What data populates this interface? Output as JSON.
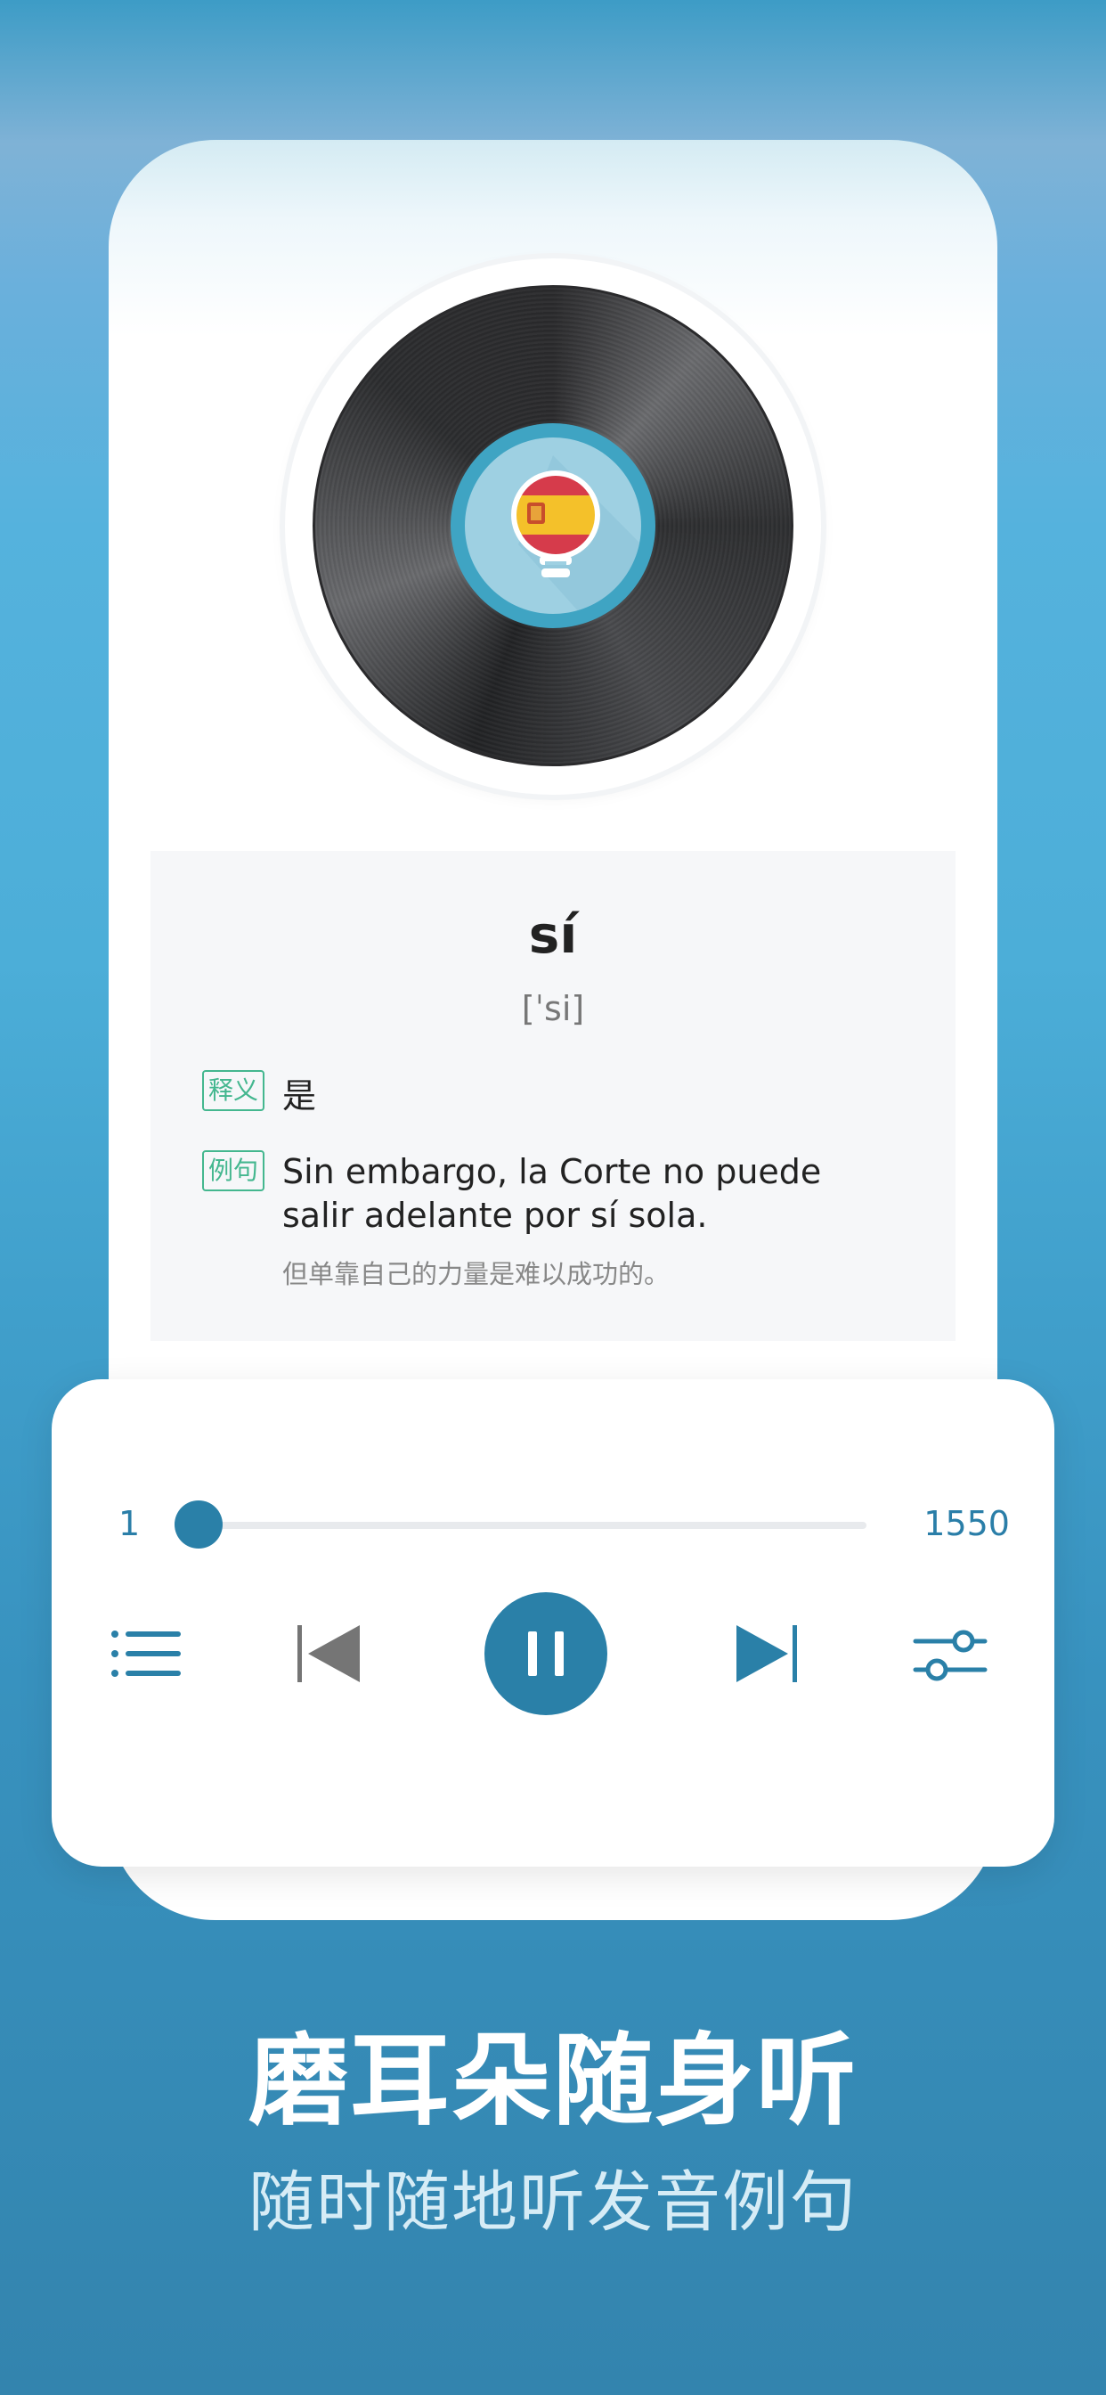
{
  "colors": {
    "accent": "#2a80a8",
    "tag_green": "#44b78f",
    "background_top": "#55b2dd",
    "background_bottom": "#3384ae"
  },
  "album_art": {
    "icon": "spain-flag-lightbulb-icon"
  },
  "word_card": {
    "word": "sí",
    "phonetic": "[ˈsi]",
    "definition_tag": "释义",
    "definition": "是",
    "example_tag": "例句",
    "example": "Sin embargo, la Corte no puede salir adelante por sí sola.",
    "example_translation": "但单靠自己的力量是难以成功的。"
  },
  "player": {
    "current_index": "1",
    "total": "1550",
    "progress": 0.0,
    "controls": [
      "list-icon",
      "previous-icon",
      "pause-icon",
      "next-icon",
      "settings-sliders-icon"
    ]
  },
  "promo": {
    "headline": "磨耳朵随身听",
    "subline": "随时随地听发音例句"
  }
}
